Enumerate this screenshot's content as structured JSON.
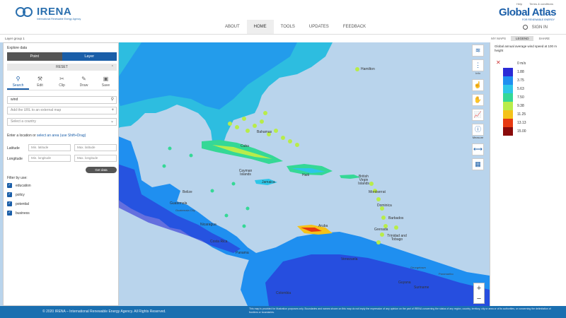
{
  "brand": {
    "name": "IRENA",
    "tagline": "International Renewable Energy Agency",
    "product": "Global Atlas",
    "product_sub": "FOR RENEWABLE ENERGY"
  },
  "toplinks": [
    "Help",
    "Terms & conditions"
  ],
  "nav": [
    "ABOUT",
    "HOME",
    "TOOLS",
    "UPDATES",
    "FEEDBACK"
  ],
  "signin": "SIGN IN",
  "layer_group": "Layer group 1",
  "right_tabs": [
    "MY MAPS",
    "LEGEND",
    "SHARE"
  ],
  "panel": {
    "title": "Explore data",
    "toggle": {
      "point": "Point",
      "layer": "Layer"
    },
    "reset": "RESET",
    "tools": [
      {
        "icon": "search-icon",
        "label": "Search"
      },
      {
        "icon": "edit-icon",
        "label": "Edit"
      },
      {
        "icon": "clip-icon",
        "label": "Clip"
      },
      {
        "icon": "draw-icon",
        "label": "Draw"
      },
      {
        "icon": "save-icon",
        "label": "Save"
      }
    ],
    "search_value": "wind",
    "url_placeholder": "Add the URL to an external map",
    "country_placeholder": "Select a country",
    "location_prefix": "Enter a location or",
    "location_link": "select an area (use Shift+Drag)",
    "latitude_label": "Latitude",
    "longitude_label": "Longitude",
    "min_lat": "Min. latitude",
    "max_lat": "Max. latitude",
    "min_lon": "Min. longitude",
    "max_lon": "Max. longitude",
    "get_data": "Get data",
    "filter_label": "Filter by use:",
    "filters": [
      "education",
      "policy",
      "potential",
      "business"
    ]
  },
  "map_buttons": [
    "layers-icon",
    "more-icon",
    "info-icon",
    "identify-icon",
    "chart-icon",
    "info-circle-icon",
    "measure-icon",
    "grid-icon"
  ],
  "map_button_labels": {
    "info": "Info",
    "measure": "Measure"
  },
  "legend": {
    "title": "Global annual average wind speed at 100 m height",
    "entries": [
      {
        "label": "0 m/s",
        "color": "#ffffff"
      },
      {
        "label": "1.88",
        "color": "#2b2bd6"
      },
      {
        "label": "3.75",
        "color": "#1f8ff0"
      },
      {
        "label": "5.63",
        "color": "#2ec6e8"
      },
      {
        "label": "7.50",
        "color": "#35d896"
      },
      {
        "label": "9.38",
        "color": "#b8ec4a"
      },
      {
        "label": "11.25",
        "color": "#f4c21a"
      },
      {
        "label": "13.13",
        "color": "#e73a12"
      },
      {
        "label": "15.00",
        "color": "#8a0b0b"
      }
    ]
  },
  "places": [
    "Hamilton",
    "Bahamas",
    "Cuba",
    "Cayman Islands",
    "Jamaica",
    "Haiti",
    "British Virgin Islands",
    "Montserrat",
    "Dominica",
    "Barbados",
    "Grenada",
    "Aruba",
    "Trinidad and Tobago",
    "Belize",
    "Guatemala",
    "Guatemala City",
    "Nicaragua",
    "Costa Rica",
    "Panama",
    "Venezuela",
    "Colombia",
    "Georgetown",
    "Guyana",
    "Paramaribo",
    "Suriname"
  ],
  "zoom": {
    "in": "+",
    "out": "−"
  },
  "footer": {
    "copyright": "© 2020 IRENA – International Renewable Energy Agency. All Rights Reserved.",
    "disclaimer": "This map is provided for illustration purposes only. Boundaries and names shown on this map do not imply the expression of any opinion on the part of IRENA concerning the status of any region, country, territory, city or area or of its authorities, or concerning the delimitation of frontiers or boundaries."
  }
}
